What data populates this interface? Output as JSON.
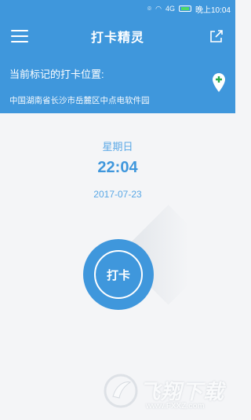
{
  "status_bar": {
    "signal_text": "4G",
    "time": "晚上10:04"
  },
  "header": {
    "title": "打卡精灵",
    "location_label": "当前标记的打卡位置:",
    "location_address": "中国湖南省长沙市岳麓区中点电软件园"
  },
  "clock": {
    "weekday": "星期日",
    "time": "22:04",
    "date": "2017-07-23"
  },
  "punch_button": {
    "label": "打卡"
  },
  "watermark": {
    "text": "飞翔下载",
    "url": "www.FXXZ.com"
  },
  "colors": {
    "primary": "#3f97dc",
    "background": "#f4f5f7"
  }
}
